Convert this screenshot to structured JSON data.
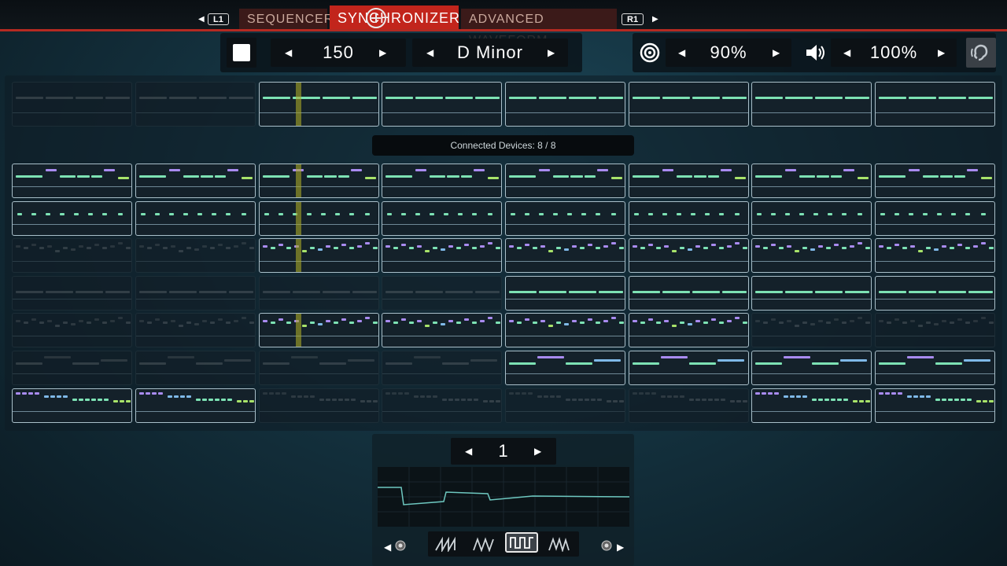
{
  "tabs": {
    "left_hint": "L1",
    "right_hint": "R1",
    "items": [
      "SEQUENCER",
      "SYNCHRONIZER",
      "ADVANCED WAVEFORM"
    ],
    "active": "SYNCHRONIZER"
  },
  "controls": {
    "tempo": "150",
    "key": "D Minor",
    "target_level": "90%",
    "volume": "100%"
  },
  "status": {
    "connected": "Connected Devices: 8 / 8"
  },
  "waveform_editor": {
    "channel": "1",
    "shapes": [
      "saw-wave",
      "triangle-wave",
      "square-wave",
      "noise-wave"
    ],
    "selected_shape": "square-wave"
  },
  "icons": [
    "stop-icon",
    "target-icon",
    "speaker-icon",
    "listen-icon",
    "crosshair-cursor-icon"
  ],
  "colors": {
    "accent": "#c2251c",
    "note_green": "#7de2b4",
    "note_lime": "#a8e36a",
    "note_purple": "#a98bf0",
    "note_blue": "#7fb9e8",
    "playhead": "#a8a828"
  },
  "pattern_grid": {
    "columns": 8,
    "top_row": {
      "pattern": "sustain",
      "active": [
        false,
        false,
        true,
        true,
        true,
        true,
        true,
        true
      ],
      "playhead_col": 2
    },
    "rows": [
      {
        "pattern": "melodyA",
        "active": [
          true,
          true,
          true,
          true,
          true,
          true,
          true,
          true
        ]
      },
      {
        "pattern": "dots",
        "active": [
          true,
          true,
          true,
          true,
          true,
          true,
          true,
          true
        ]
      },
      {
        "pattern": "arpeggio",
        "active": [
          false,
          false,
          true,
          true,
          true,
          true,
          true,
          true
        ]
      },
      {
        "pattern": "sustain",
        "active": [
          false,
          false,
          false,
          false,
          true,
          true,
          true,
          true
        ]
      },
      {
        "pattern": "arpeggio",
        "active": [
          false,
          false,
          true,
          true,
          true,
          true,
          false,
          false
        ]
      },
      {
        "pattern": "pad",
        "active": [
          false,
          false,
          false,
          false,
          true,
          true,
          true,
          true
        ]
      },
      {
        "pattern": "descend",
        "active": [
          true,
          true,
          false,
          false,
          false,
          false,
          true,
          true
        ]
      }
    ],
    "playhead_col": 2
  }
}
